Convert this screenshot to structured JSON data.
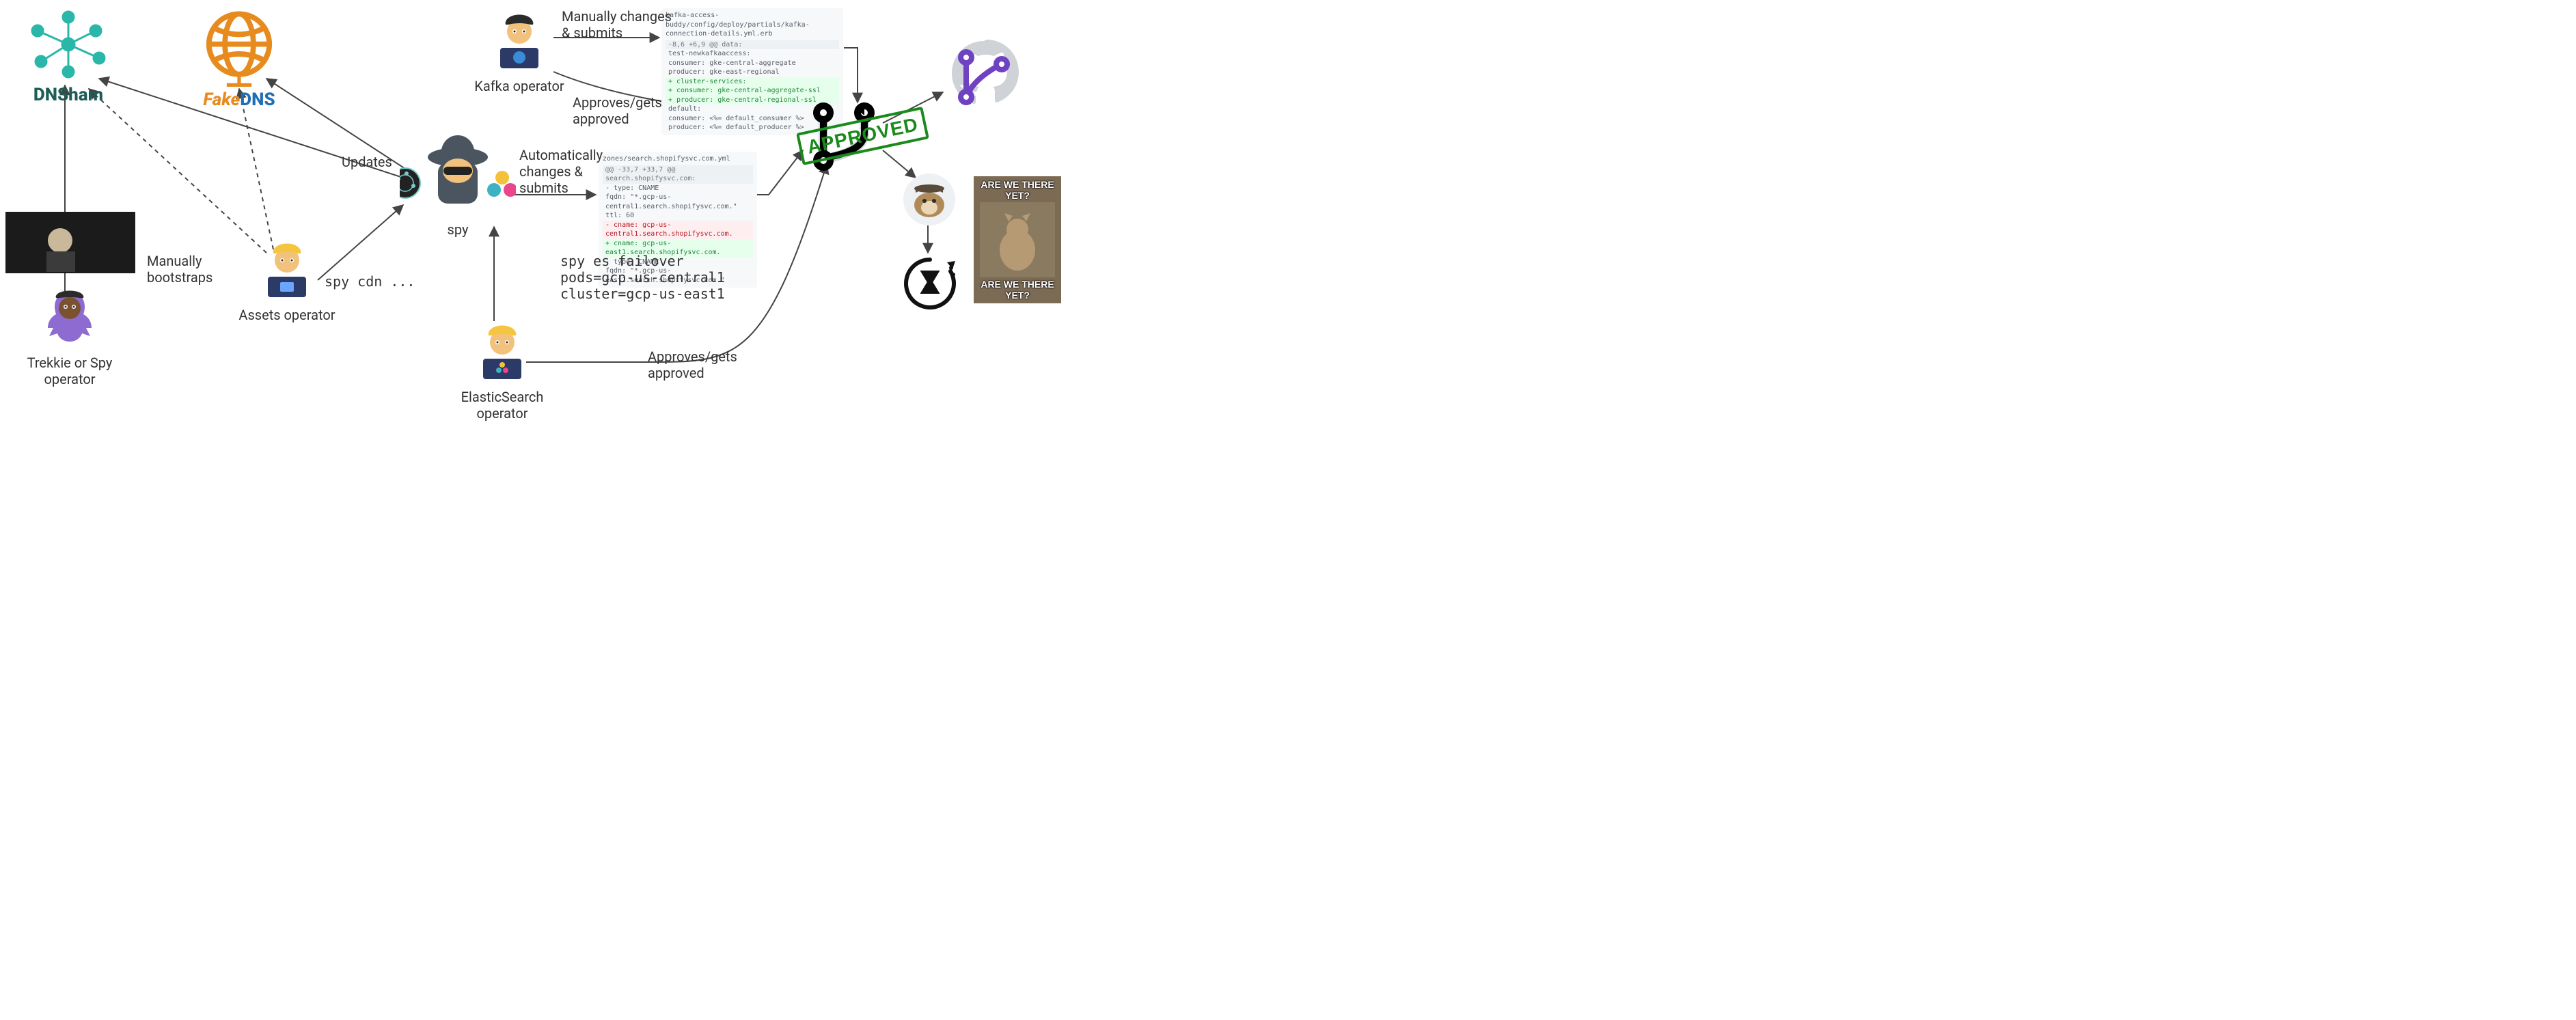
{
  "nodes": {
    "dnsham": {
      "label": "DNSham"
    },
    "fakedns": {
      "brand_left": "Fake",
      "brand_right": "DNS"
    },
    "trekkie_spy_op": {
      "label": "Trekkie or Spy\noperator"
    },
    "assets_op": {
      "label": "Assets operator"
    },
    "kafka_op": {
      "label": "Kafka operator"
    },
    "es_op": {
      "label": "ElasticSearch\noperator"
    },
    "spy": {
      "label": "spy"
    }
  },
  "edges": {
    "manual_bootstraps": "Manually\nbootstraps",
    "updates": "Updates",
    "spy_cdn_cmd": "spy cdn ...",
    "kafka_manual": "Manually changes\n& submits",
    "kafka_approves": "Approves/gets\napproved",
    "spy_auto": "Automatically\nchanges &\nsubmits",
    "es_approves": "Approves/gets\napproved",
    "spy_es_cmd": "spy es failover\npods=gcp-us-central1\ncluster=gcp-us-east1"
  },
  "diffs": {
    "kafka": {
      "path": "kafka-access-buddy/config/deploy/partials/kafka-connection-details.yml.erb",
      "hunk": "-8,6 +6,9 @@ data:",
      "lines": [
        {
          "t": "ctx",
          "text": "  test-newkafkaaccess:"
        },
        {
          "t": "ctx",
          "text": "    consumer: gke-central-aggregate"
        },
        {
          "t": "ctx",
          "text": "    producer: gke-east-regional"
        },
        {
          "t": "add",
          "text": "+  cluster-services:"
        },
        {
          "t": "add",
          "text": "+    consumer: gke-central-aggregate-ssl"
        },
        {
          "t": "add",
          "text": "+    producer: gke-central-regional-ssl"
        },
        {
          "t": "ctx",
          "text": "  default:"
        },
        {
          "t": "ctx",
          "text": "    consumer: <%= default_consumer %>"
        },
        {
          "t": "ctx",
          "text": "    producer: <%= default_producer %>"
        }
      ]
    },
    "es": {
      "path": "zones/search.shopifysvc.com.yml",
      "hunk": "@@ -33,7 +33,7 @@ search.shopifysvc.com:",
      "lines": [
        {
          "t": "ctx",
          "text": "  - type: CNAME"
        },
        {
          "t": "ctx",
          "text": "    fqdn: \"*.gcp-us-central1.search.shopifysvc.com.\""
        },
        {
          "t": "ctx",
          "text": "    ttl: 60"
        },
        {
          "t": "del",
          "text": "-   cname: gcp-us-central1.search.shopifysvc.com."
        },
        {
          "t": "add",
          "text": "+   cname: gcp-us-east1.search.shopifysvc.com."
        },
        {
          "t": "ctx",
          "text": " "
        },
        {
          "t": "ctx",
          "text": "  - type: CNAME"
        },
        {
          "t": "ctx",
          "text": "    fqdn: \"*.gcp-us-east1.search.shopifysvc.com.\""
        }
      ]
    }
  },
  "stamp": "APPROVED",
  "meme_cat": {
    "top": "ARE WE THERE YET?",
    "bottom": "ARE WE THERE YET?"
  }
}
